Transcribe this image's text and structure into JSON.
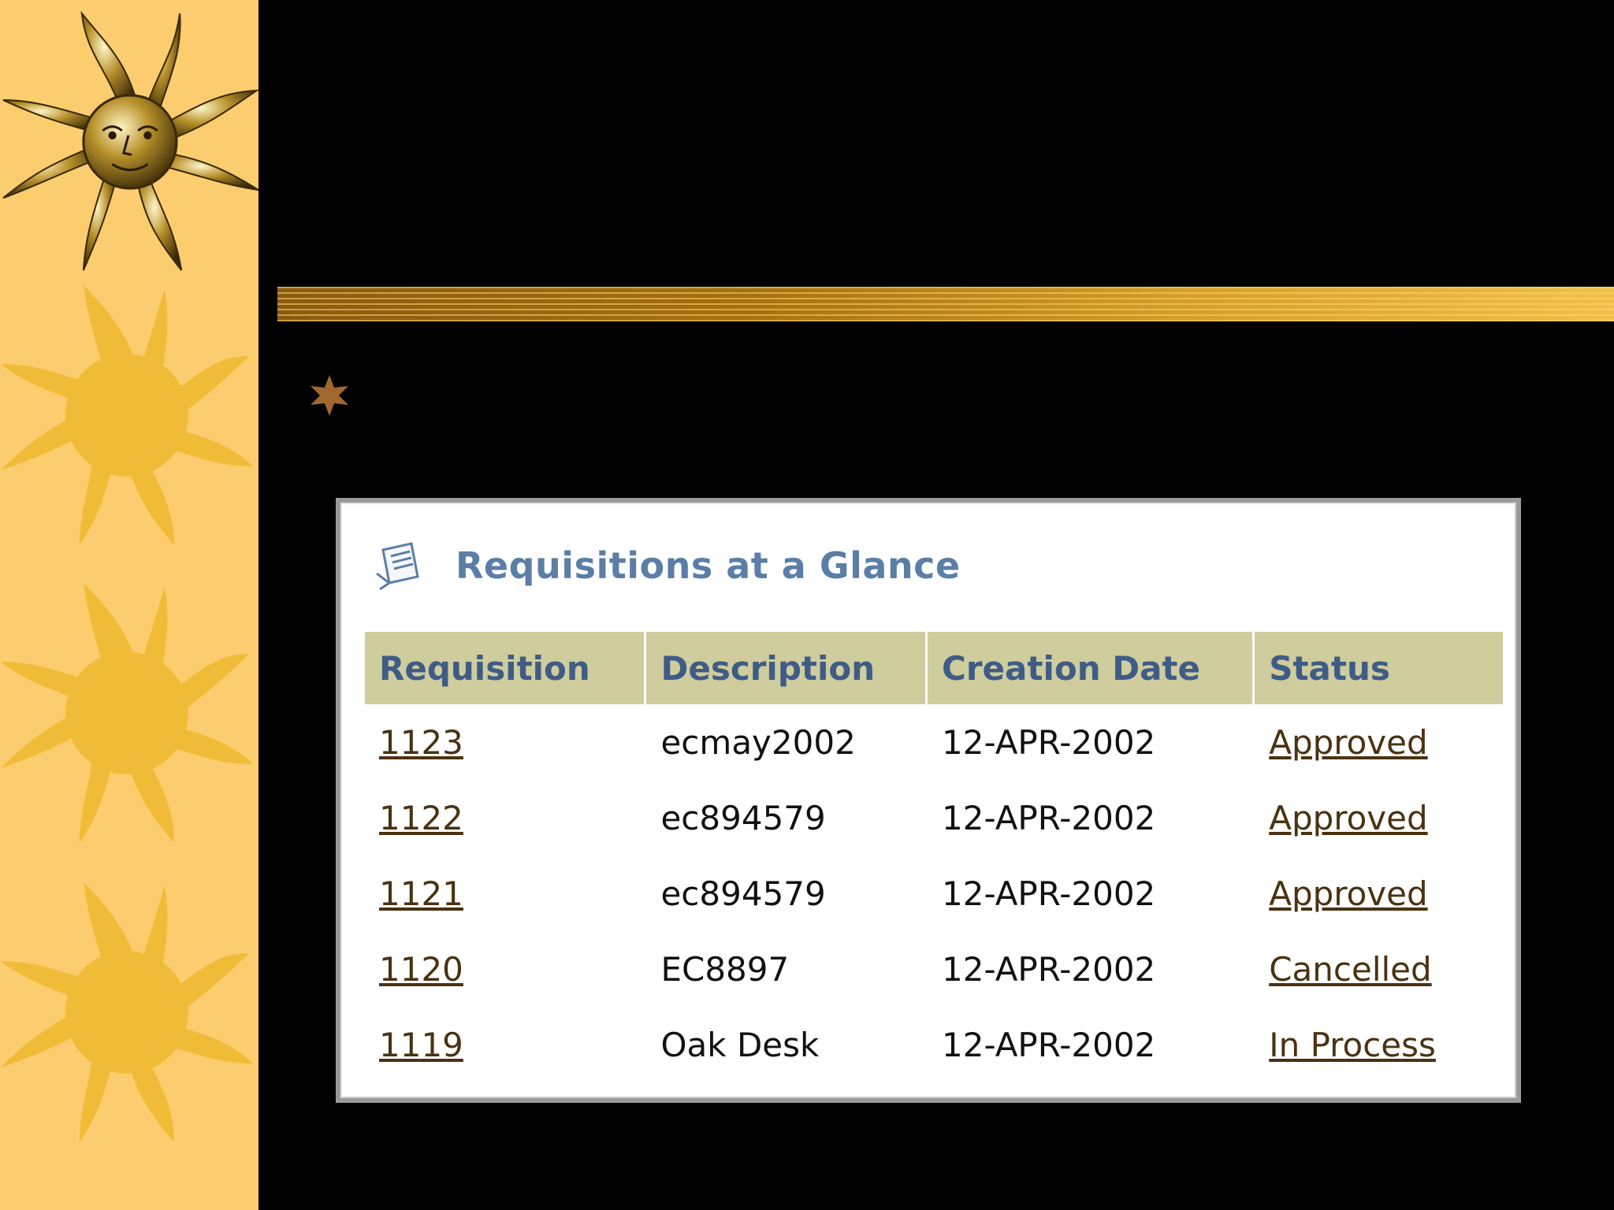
{
  "panel": {
    "title": "Requisitions at a Glance",
    "icon": "document-icon"
  },
  "table": {
    "headers": [
      "Requisition",
      "Description",
      "Creation Date",
      "Status"
    ],
    "rows": [
      {
        "requisition": "1123",
        "description": "ecmay2002",
        "date": "12-APR-2002",
        "status": "Approved"
      },
      {
        "requisition": "1122",
        "description": "ec894579",
        "date": "12-APR-2002",
        "status": "Approved"
      },
      {
        "requisition": "1121",
        "description": "ec894579",
        "date": "12-APR-2002",
        "status": "Approved"
      },
      {
        "requisition": "1120",
        "description": "EC8897",
        "date": "12-APR-2002",
        "status": "Cancelled"
      },
      {
        "requisition": "1119",
        "description": "Oak Desk",
        "date": "12-APR-2002",
        "status": "In Process"
      }
    ]
  },
  "colors": {
    "sidebar": "#fccd6e",
    "sun": "#f0bc38",
    "header_bg": "#cfcc9d",
    "header_text": "#3f5c86",
    "title": "#5b7ea6",
    "link": "#4a3212",
    "bullet": "#a0682e"
  },
  "decor": {
    "bullet_icon": "star-bullet-icon",
    "sidebar_icons": [
      "sun-face-icon",
      "sun-icon",
      "sun-icon",
      "sun-icon"
    ]
  }
}
